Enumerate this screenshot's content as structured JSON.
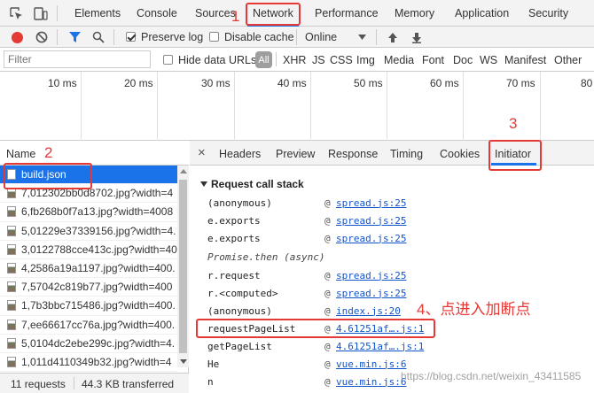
{
  "tabs": [
    "Elements",
    "Console",
    "Sources",
    "Network",
    "Performance",
    "Memory",
    "Application",
    "Security"
  ],
  "toolbar": {
    "preserve_log": "Preserve log",
    "disable_cache": "Disable cache",
    "throttle": "Online"
  },
  "filter": {
    "placeholder": "Filter",
    "hide_data_urls": "Hide data URLs",
    "all": "All",
    "types": [
      "XHR",
      "JS",
      "CSS",
      "Img",
      "Media",
      "Font",
      "Doc",
      "WS",
      "Manifest",
      "Other"
    ]
  },
  "timeline": {
    "ticks": [
      "10 ms",
      "20 ms",
      "30 ms",
      "40 ms",
      "50 ms",
      "60 ms",
      "70 ms",
      "80"
    ]
  },
  "requests": {
    "header": "Name",
    "items": [
      "build.json",
      "7,012302bb0d8702.jpg?width=4",
      "6,fb268b0f7a13.jpg?width=4008",
      "5,01229e37339156.jpg?width=4.",
      "3,0122788cce413c.jpg?width=40",
      "4,2586a19a1197.jpg?width=400.",
      "7,57042c819b77.jpg?width=400",
      "1,7b3bbc715486.jpg?width=400.",
      "7,ee66617cc76a.jpg?width=400.",
      "5,0104dc2ebe299c.jpg?width=4.",
      "1,011d4110349b32.jpg?width=4"
    ],
    "status_count": "11 requests",
    "status_size": "44.3 KB transferred"
  },
  "detail": {
    "close": "×",
    "tabs": [
      "Headers",
      "Preview",
      "Response",
      "Timing",
      "Cookies",
      "Initiator"
    ],
    "section_title": "Request call stack",
    "stack": [
      {
        "fn": "(anonymous)",
        "at": "@",
        "src": "spread.js:25"
      },
      {
        "fn": "e.exports",
        "at": "@",
        "src": "spread.js:25"
      },
      {
        "fn": "e.exports",
        "at": "@",
        "src": "spread.js:25"
      },
      {
        "fn": "Promise.then (async)",
        "at": "",
        "src": ""
      },
      {
        "fn": "r.request",
        "at": "@",
        "src": "spread.js:25"
      },
      {
        "fn": "r.<computed>",
        "at": "@",
        "src": "spread.js:25"
      },
      {
        "fn": "(anonymous)",
        "at": "@",
        "src": "index.js:20"
      },
      {
        "fn": "requestPageList",
        "at": "@",
        "src": "4.61251af….js:1"
      },
      {
        "fn": "getPageList",
        "at": "@",
        "src": "4.61251af….js:1"
      },
      {
        "fn": "He",
        "at": "@",
        "src": "vue.min.js:6"
      },
      {
        "fn": "n",
        "at": "@",
        "src": "vue.min.js:6"
      }
    ]
  },
  "annotations": {
    "a1": "1",
    "a2": "2",
    "a3": "3",
    "a4": "4、点进入加断点",
    "watermark": "https://blog.csdn.net/weixin_43411585"
  },
  "colors": {
    "annotation": "#e53935",
    "selected_row": "#1a73e8",
    "link": "#1155cc"
  }
}
